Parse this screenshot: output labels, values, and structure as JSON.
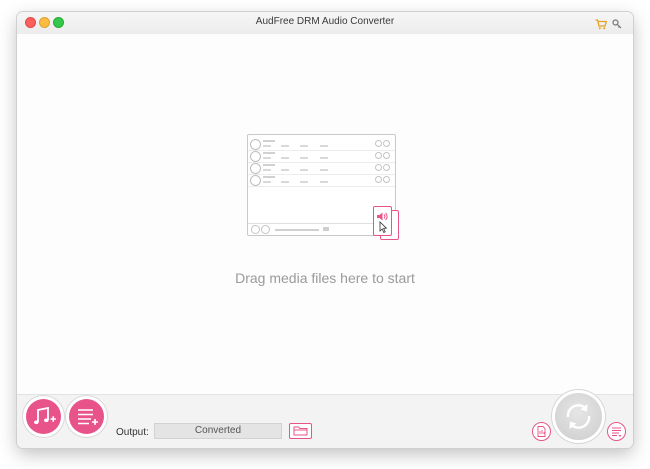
{
  "window": {
    "title": "AudFree DRM Audio Converter"
  },
  "toolbar_icons": [
    "cart-icon",
    "key-icon"
  ],
  "main": {
    "drop_hint": "Drag media files here to start"
  },
  "bottom": {
    "add_music_icon": "music-note-plus-icon",
    "add_list_icon": "list-plus-icon",
    "output_label": "Output:",
    "output_value": "Converted",
    "folder_icon": "folder-icon",
    "history_icon": "file-history-icon",
    "convert_icon": "convert-arrows-icon",
    "format_icon": "format-settings-icon"
  },
  "colors": {
    "accent": "#e8538a",
    "close": "#fc605c",
    "minimize": "#fdbc40",
    "zoom": "#34c84a"
  }
}
